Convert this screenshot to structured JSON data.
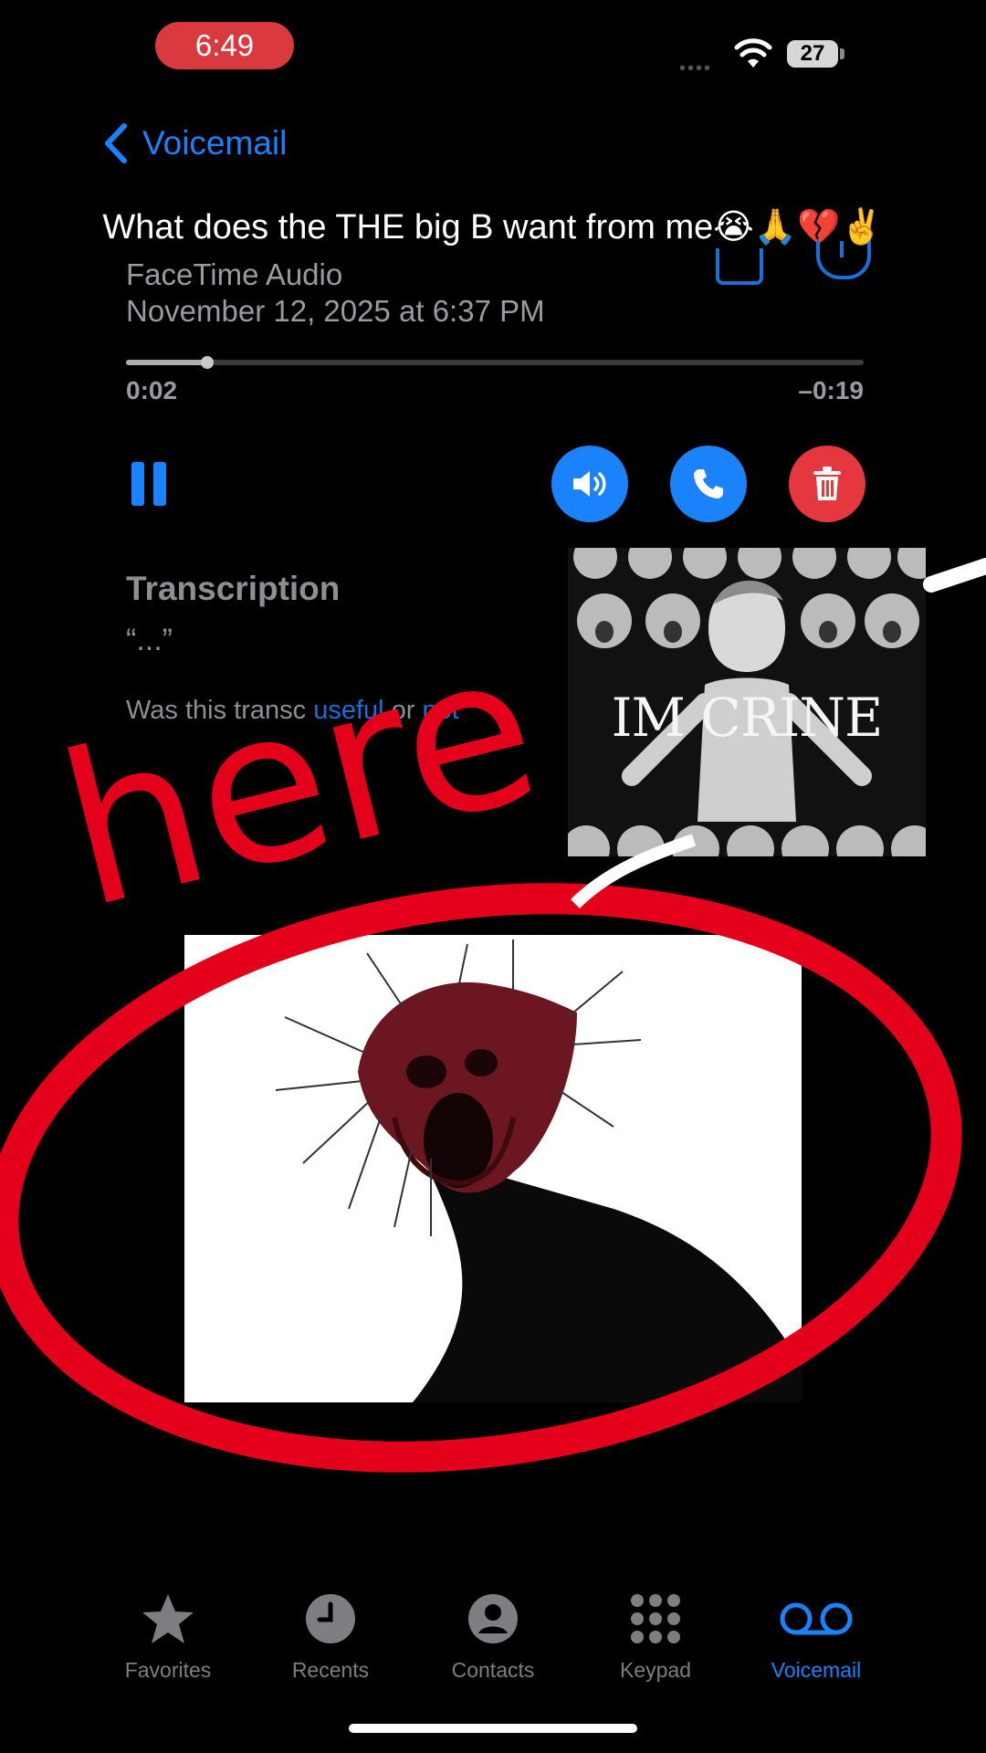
{
  "status_bar": {
    "time": "6:49",
    "signal": "••••",
    "battery": "27"
  },
  "nav": {
    "back_label": "Voicemail"
  },
  "caption": "What does the THE big B want from me😭🙏💔✌️",
  "voicemail": {
    "type": "FaceTime Audio",
    "date": "November 12, 2025 at 6:37 PM",
    "elapsed": "0:02",
    "remaining": "–0:19",
    "progress": 0.11
  },
  "transcription": {
    "title": "Transcription",
    "text": "“...”",
    "feedback_prefix": "Was this transc",
    "feedback_mid": "useful",
    "feedback_or": " or ",
    "feedback_not": "not"
  },
  "overlays": {
    "scribble_text": "here",
    "meme_text": "IM CRINE"
  },
  "tabs": [
    {
      "label": "Favorites",
      "icon": "star-icon"
    },
    {
      "label": "Recents",
      "icon": "clock-icon"
    },
    {
      "label": "Contacts",
      "icon": "person-icon"
    },
    {
      "label": "Keypad",
      "icon": "keypad-icon"
    },
    {
      "label": "Voicemail",
      "icon": "voicemail-icon"
    }
  ],
  "colors": {
    "accent": "#1a82fb",
    "delete": "#e5373e",
    "scribble": "#e4001b",
    "time_pill": "#d93a3f"
  }
}
